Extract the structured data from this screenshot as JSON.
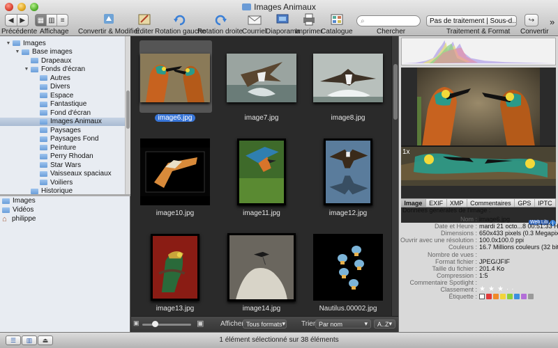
{
  "window": {
    "title": "Images Animaux"
  },
  "toolbar": {
    "back_label": "Précédente",
    "view_label": "Affichage",
    "convert_modify_label": "Convertir & Modifier",
    "edit_label": "Éditer",
    "rotate_left_label": "Rotation gauche",
    "rotate_right_label": "Rotation droite",
    "mail_label": "Courriel",
    "slideshow_label": "Diaporama",
    "print_label": "Imprimer",
    "catalog_label": "Catalogue",
    "search_label": "Chercher",
    "search_placeholder": "",
    "processing_value": "Pas de traitement | Sous-d...",
    "processing_label": "Traitement & Format",
    "convert_label": "Convertir",
    "overflow_glyph": "»"
  },
  "sidebar": {
    "tree": [
      {
        "label": "Images",
        "depth": 0,
        "open": true,
        "selected": false
      },
      {
        "label": "Base images",
        "depth": 1,
        "open": true,
        "selected": false
      },
      {
        "label": "Drapeaux",
        "depth": 2,
        "open": null,
        "selected": false
      },
      {
        "label": "Fonds d'écran",
        "depth": 2,
        "open": true,
        "selected": false
      },
      {
        "label": "Autres",
        "depth": 3,
        "open": null,
        "selected": false
      },
      {
        "label": "Divers",
        "depth": 3,
        "open": null,
        "selected": false
      },
      {
        "label": "Espace",
        "depth": 3,
        "open": null,
        "selected": false
      },
      {
        "label": "Fantastique",
        "depth": 3,
        "open": null,
        "selected": false
      },
      {
        "label": "Fond d'écran",
        "depth": 3,
        "open": null,
        "selected": false
      },
      {
        "label": "Images Animaux",
        "depth": 3,
        "open": null,
        "selected": true
      },
      {
        "label": "Paysages",
        "depth": 3,
        "open": null,
        "selected": false
      },
      {
        "label": "Paysages Fond",
        "depth": 3,
        "open": null,
        "selected": false
      },
      {
        "label": "Peinture",
        "depth": 3,
        "open": null,
        "selected": false
      },
      {
        "label": "Perry Rhodan",
        "depth": 3,
        "open": null,
        "selected": false
      },
      {
        "label": "Star Wars",
        "depth": 3,
        "open": null,
        "selected": false
      },
      {
        "label": "Vaisseaux spaciaux",
        "depth": 3,
        "open": null,
        "selected": false
      },
      {
        "label": "Voiliers",
        "depth": 3,
        "open": null,
        "selected": false
      },
      {
        "label": "Historique",
        "depth": 2,
        "open": null,
        "selected": false
      }
    ],
    "places": [
      {
        "label": "Images",
        "icon": "folder-icon"
      },
      {
        "label": "Vidéos",
        "icon": "folder-icon"
      },
      {
        "label": "philippe",
        "icon": "home-icon"
      }
    ]
  },
  "grid": {
    "thumbs": [
      {
        "name": "image6.jpg",
        "selected": true,
        "subject": "bee-eaters",
        "orient": "land"
      },
      {
        "name": "image7.jpg",
        "selected": false,
        "subject": "osprey-water",
        "orient": "land"
      },
      {
        "name": "image8.jpg",
        "selected": false,
        "subject": "osprey-splash",
        "orient": "land"
      },
      {
        "name": "image10.jpg",
        "selected": false,
        "subject": "pelican",
        "orient": "land-dark"
      },
      {
        "name": "image11.jpg",
        "selected": false,
        "subject": "kingfisher",
        "orient": "port"
      },
      {
        "name": "image12.jpg",
        "selected": false,
        "subject": "eagle-reflection",
        "orient": "port"
      },
      {
        "name": "image13.jpg",
        "selected": false,
        "subject": "chameleon",
        "orient": "port"
      },
      {
        "name": "image14.jpg",
        "selected": false,
        "subject": "bird-on-rock",
        "orient": "square"
      },
      {
        "name": "Nautilus.00002.jpg",
        "selected": false,
        "subject": "jellyfish",
        "orient": "land-dark"
      }
    ],
    "show_label": "Afficher :",
    "show_value": "Tous formats",
    "sort_label": "Trier",
    "sort_value": "Par nom",
    "order_value": "A..Z"
  },
  "inspector": {
    "zoom_label": "1x",
    "badges": [
      "Web",
      "Lib",
      "i"
    ],
    "tabs": [
      "Image",
      "EXIF",
      "XMP",
      "Commentaires",
      "GPS",
      "IPTC"
    ],
    "active_tab": "Image",
    "section_title": "Données générales de l'image :",
    "fields": [
      {
        "key": "Nom :",
        "value": "image6.jpg"
      },
      {
        "key": "Date et Heure :",
        "value": "mardi 21 octo...8 00:51:33 HEC"
      },
      {
        "key": "Dimensions :",
        "value": "650x433 pixels (0.3 Megapixels)"
      },
      {
        "key": "Ouvrir avec une résolution :",
        "value": "100.0x100.0 ppi"
      },
      {
        "key": "Couleurs :",
        "value": "16.7 Millions couleurs (32 bits)"
      },
      {
        "key": "Nombre de vues :",
        "value": ""
      },
      {
        "key": "Format fichier :",
        "value": "JPEG/JFIF"
      },
      {
        "key": "Taille du fichier :",
        "value": "201.4 Ko"
      },
      {
        "key": "Compression :",
        "value": "1:5"
      },
      {
        "key": "Commentaire Spotlight :",
        "value": ""
      },
      {
        "key": "Classement :",
        "value": ""
      },
      {
        "key": "Étiquette :",
        "value": ""
      }
    ],
    "rating": 3,
    "rating_max": 5,
    "label_colors": [
      "#e23b3b",
      "#f08a2a",
      "#f2d43a",
      "#8ccf3c",
      "#3c8fe0",
      "#b36ed8",
      "#9a9a9a"
    ]
  },
  "status": {
    "text": "1 élément sélectionné sur 38 éléments"
  }
}
